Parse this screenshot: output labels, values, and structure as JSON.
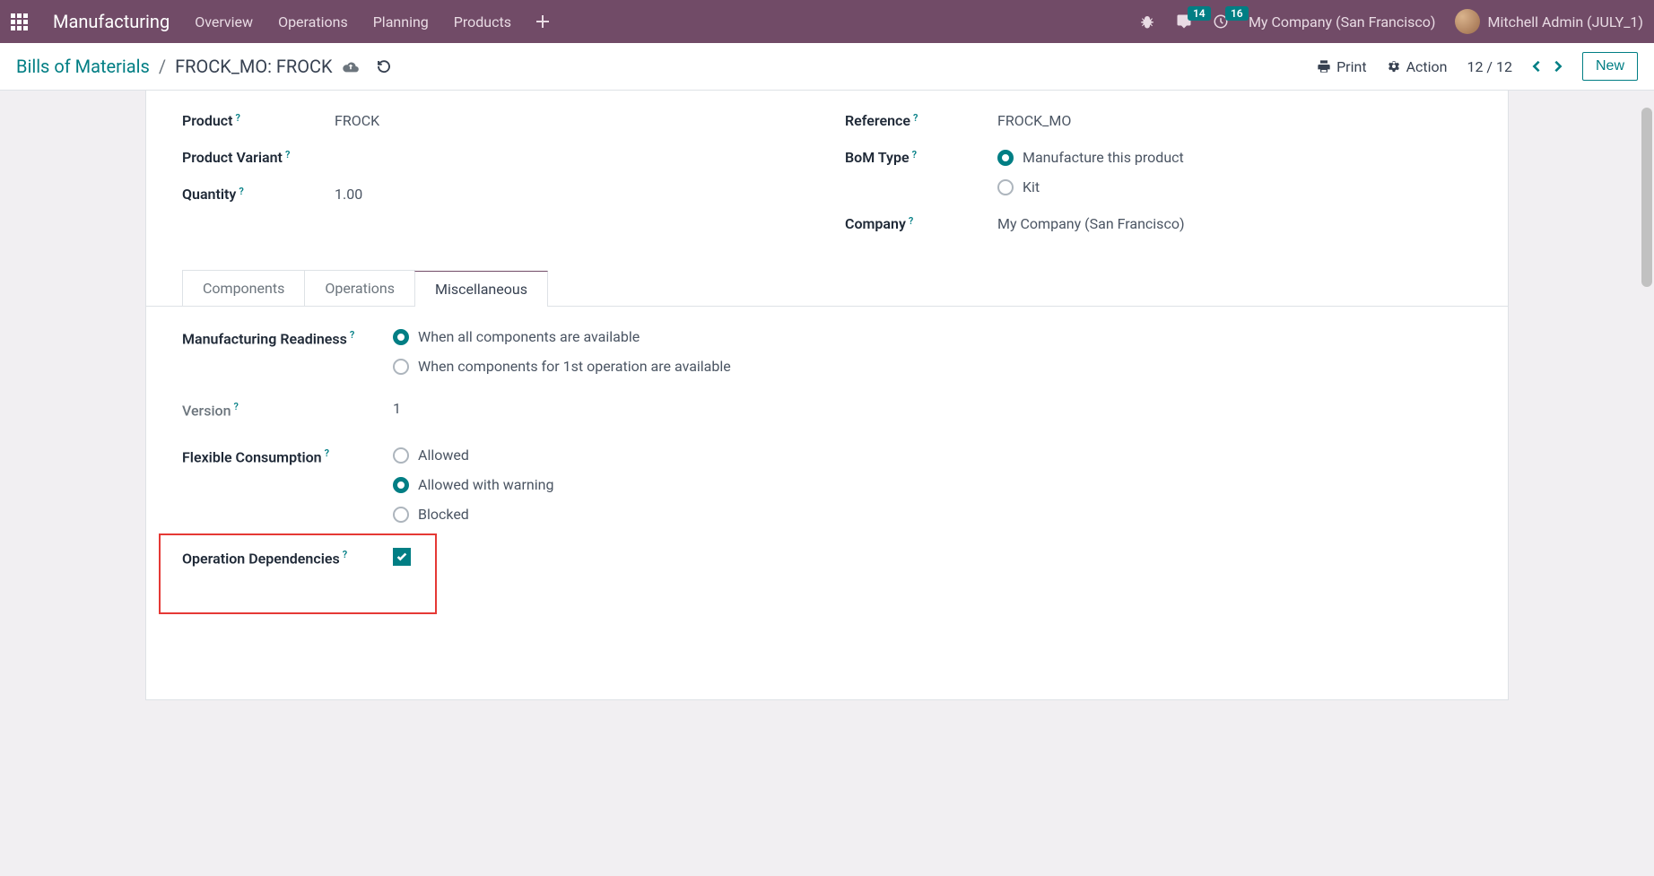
{
  "topbar": {
    "brand": "Manufacturing",
    "nav": [
      "Overview",
      "Operations",
      "Planning",
      "Products"
    ],
    "msg_badge": "14",
    "clock_badge": "16",
    "company": "My Company (San Francisco)",
    "user": "Mitchell Admin (JULY_1)"
  },
  "subbar": {
    "breadcrumb_root": "Bills of Materials",
    "breadcrumb_current": "FROCK_MO: FROCK",
    "print": "Print",
    "action": "Action",
    "pager": "12 / 12",
    "new_btn": "New"
  },
  "form": {
    "labels": {
      "product": "Product",
      "product_variant": "Product Variant",
      "quantity": "Quantity",
      "reference": "Reference",
      "bom_type": "BoM Type",
      "company": "Company"
    },
    "product": "FROCK",
    "quantity": "1.00",
    "reference": "FROCK_MO",
    "bom_type_options": {
      "manufacture": "Manufacture this product",
      "kit": "Kit"
    },
    "bom_type_selected": "manufacture",
    "company": "My Company (San Francisco)"
  },
  "tabs": {
    "components": "Components",
    "operations": "Operations",
    "miscellaneous": "Miscellaneous",
    "active": "miscellaneous"
  },
  "misc": {
    "labels": {
      "mfg_readiness": "Manufacturing Readiness",
      "version": "Version",
      "flex_consumption": "Flexible Consumption",
      "op_deps": "Operation Dependencies"
    },
    "readiness_options": {
      "all": "When all components are available",
      "first": "When components for 1st operation are available"
    },
    "readiness_selected": "all",
    "version": "1",
    "flex_options": {
      "allowed": "Allowed",
      "warning": "Allowed with warning",
      "blocked": "Blocked"
    },
    "flex_selected": "warning",
    "op_deps_checked": true
  }
}
